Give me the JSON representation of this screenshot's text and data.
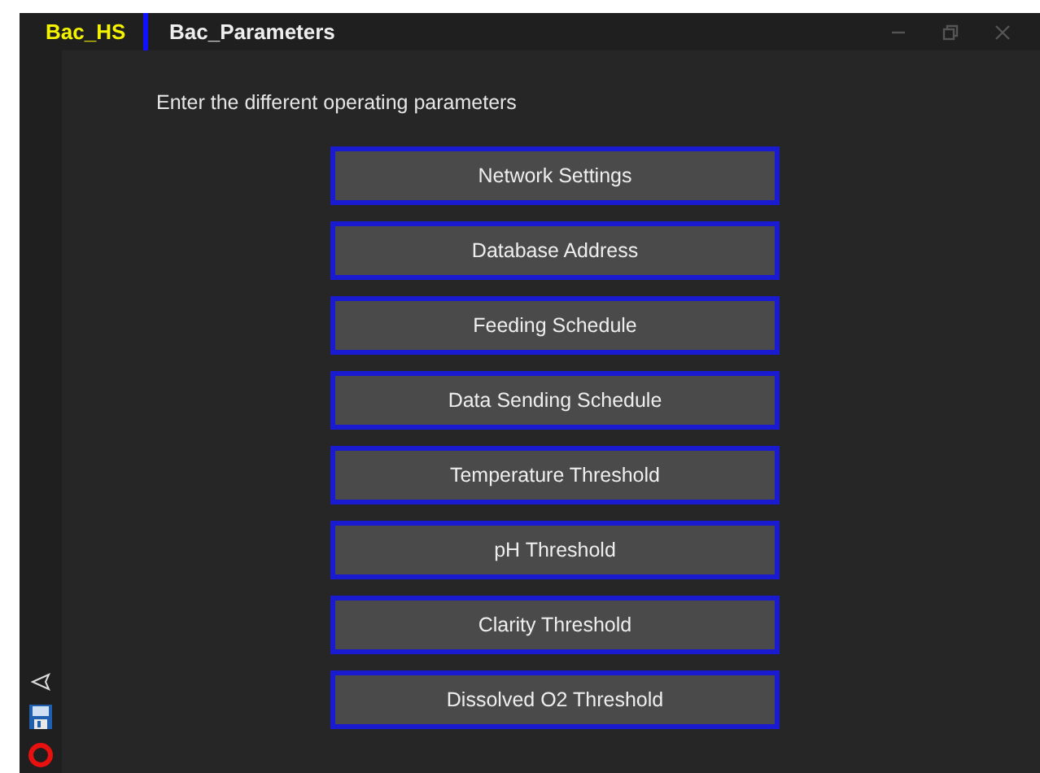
{
  "app_name": "Bac_HS",
  "tabs": [
    {
      "label": "Bac_Parameters",
      "selected": true
    }
  ],
  "prompt": "Enter the different operating parameters",
  "buttons": [
    "Network Settings",
    "Database Address",
    "Feeding Schedule",
    "Data Sending Schedule",
    "Temperature Threshold",
    "pH Threshold",
    "Clarity Threshold",
    "Dissolved O2 Threshold"
  ]
}
